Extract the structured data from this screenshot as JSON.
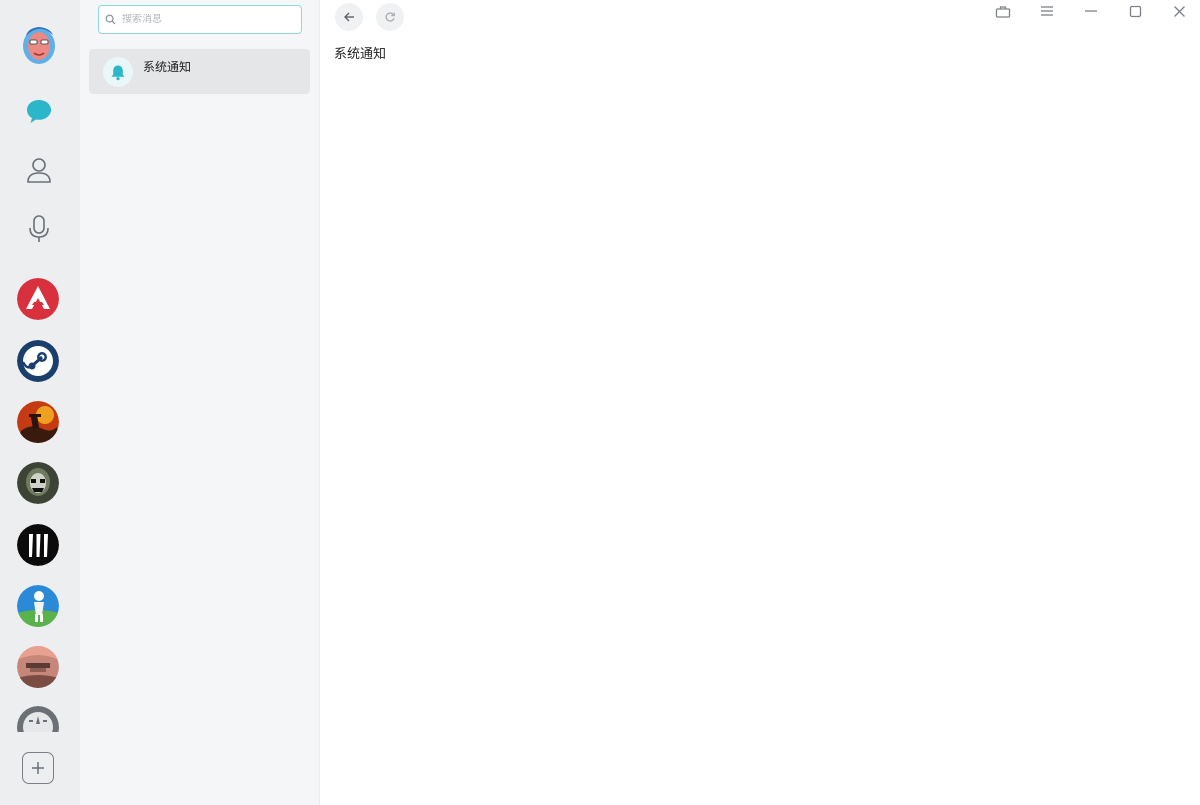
{
  "search": {
    "placeholder": "搜索消息"
  },
  "conversations": [
    {
      "name": "系统通知",
      "icon": "bell-icon"
    }
  ],
  "main": {
    "title": "系统通知"
  },
  "rail": {
    "nav": [
      "chat-bubble-icon",
      "user-icon",
      "microphone-icon"
    ],
    "games": [
      "apex-legends",
      "steam",
      "red-dead-redemption",
      "call-of-duty",
      "three-bars-game",
      "golf-game",
      "gta-v",
      "more-game"
    ]
  },
  "colors": {
    "accent": "#2bb7c9",
    "rail_bg": "#eceef0",
    "list_bg": "#f5f6f7",
    "selected_bg": "#e5e6e8"
  }
}
